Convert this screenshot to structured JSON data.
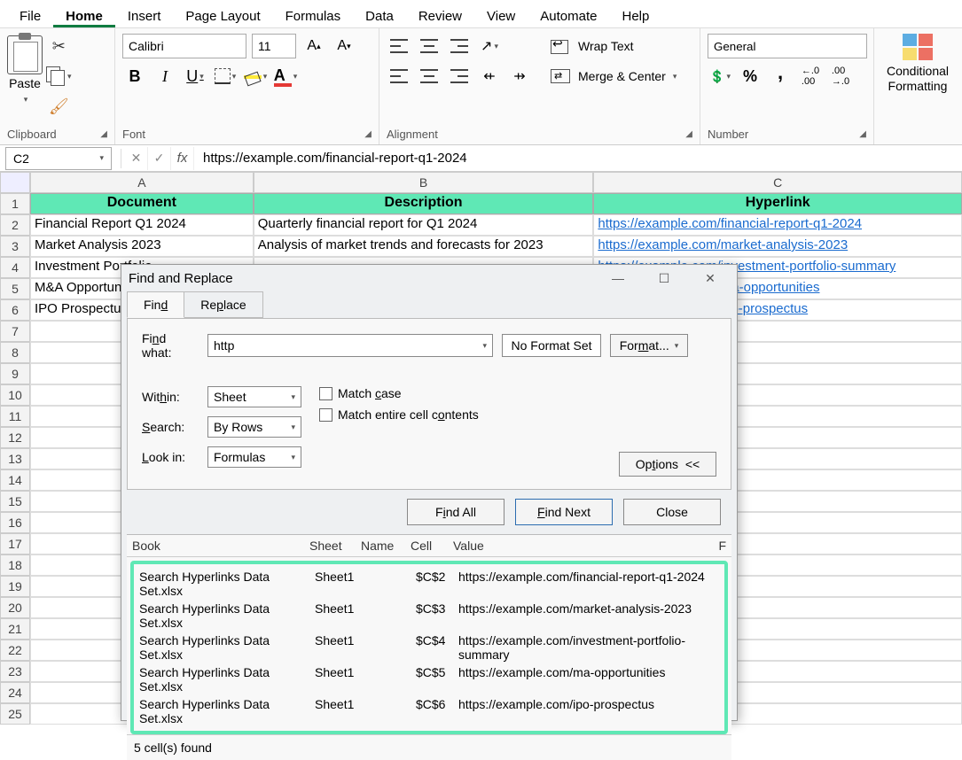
{
  "menubar": [
    "File",
    "Home",
    "Insert",
    "Page Layout",
    "Formulas",
    "Data",
    "Review",
    "View",
    "Automate",
    "Help"
  ],
  "activeMenu": "Home",
  "ribbon": {
    "clipboard": {
      "paste": "Paste",
      "label": "Clipboard"
    },
    "font": {
      "name": "Calibri",
      "size": "11",
      "label": "Font"
    },
    "alignment": {
      "wrap": "Wrap Text",
      "merge": "Merge & Center",
      "label": "Alignment"
    },
    "number": {
      "format": "General",
      "label": "Number"
    },
    "cf": {
      "label": "Conditional Formatting"
    }
  },
  "formulaBar": {
    "nameBox": "C2",
    "value": "https://example.com/financial-report-q1-2024"
  },
  "columns": [
    "A",
    "B",
    "C"
  ],
  "headerRow": {
    "A": "Document",
    "B": "Description",
    "C": "Hyperlink"
  },
  "rows": [
    {
      "n": "2",
      "A": "Financial Report Q1 2024",
      "B": "Quarterly financial report for Q1 2024",
      "C": "https://example.com/financial-report-q1-2024"
    },
    {
      "n": "3",
      "A": "Market Analysis 2023",
      "B": "Analysis of market trends and forecasts for 2023",
      "C": "https://example.com/market-analysis-2023"
    },
    {
      "n": "4",
      "A": "Investment Portfolio",
      "B": "",
      "C": "https://example.com/investment-portfolio-summary"
    },
    {
      "n": "5",
      "A": "M&A Opportunities",
      "B": "",
      "C": "https://example.com/ma-opportunities"
    },
    {
      "n": "6",
      "A": "IPO Prospectus",
      "B": "",
      "C": "https://example.com/ipo-prospectus"
    }
  ],
  "emptyRows": [
    "7",
    "8",
    "9",
    "10",
    "11",
    "12",
    "13",
    "14",
    "15",
    "16",
    "17",
    "18",
    "19",
    "20",
    "21",
    "22",
    "23",
    "24",
    "25"
  ],
  "dialog": {
    "title": "Find and Replace",
    "tabs": {
      "find": "Find",
      "replace": "Replace"
    },
    "findWhatLabel": "Find what:",
    "findWhatValue": "http",
    "noFormat": "No Format Set",
    "formatBtn": "Format...",
    "withinLabel": "Within:",
    "withinValue": "Sheet",
    "searchLabel": "Search:",
    "searchValue": "By Rows",
    "lookinLabel": "Look in:",
    "lookinValue": "Formulas",
    "matchCase": "Match case",
    "matchEntire": "Match entire cell contents",
    "options": "Options <<",
    "findAll": "Find All",
    "findNext": "Find Next",
    "close": "Close",
    "resultHeaders": {
      "book": "Book",
      "sheet": "Sheet",
      "name": "Name",
      "cell": "Cell",
      "value": "Value",
      "f": "F"
    },
    "results": [
      {
        "book": "Search Hyperlinks Data Set.xlsx",
        "sheet": "Sheet1",
        "cell": "$C$2",
        "value": "https://example.com/financial-report-q1-2024"
      },
      {
        "book": "Search Hyperlinks Data Set.xlsx",
        "sheet": "Sheet1",
        "cell": "$C$3",
        "value": "https://example.com/market-analysis-2023"
      },
      {
        "book": "Search Hyperlinks Data Set.xlsx",
        "sheet": "Sheet1",
        "cell": "$C$4",
        "value": "https://example.com/investment-portfolio-summary"
      },
      {
        "book": "Search Hyperlinks Data Set.xlsx",
        "sheet": "Sheet1",
        "cell": "$C$5",
        "value": "https://example.com/ma-opportunities"
      },
      {
        "book": "Search Hyperlinks Data Set.xlsx",
        "sheet": "Sheet1",
        "cell": "$C$6",
        "value": "https://example.com/ipo-prospectus"
      }
    ],
    "status": "5 cell(s) found"
  }
}
